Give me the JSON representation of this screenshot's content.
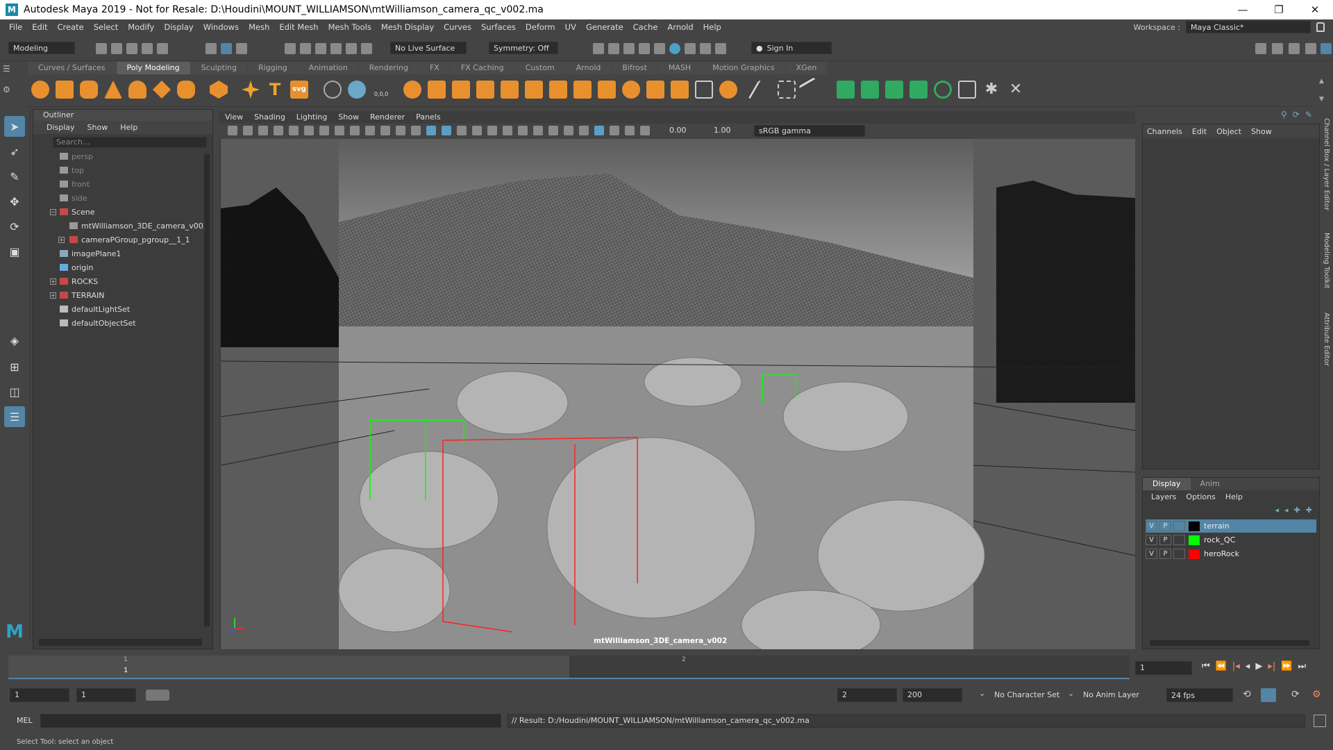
{
  "window": {
    "title": "Autodesk Maya 2019 - Not for Resale: D:\\Houdini\\MOUNT_WILLIAMSON\\mtWilliamson_camera_qc_v002.ma",
    "logo": "M",
    "controls": {
      "minimize": "—",
      "maximize": "❐",
      "close": "✕"
    }
  },
  "menubar": {
    "items": [
      "File",
      "Edit",
      "Create",
      "Select",
      "Modify",
      "Display",
      "Windows",
      "Mesh",
      "Edit Mesh",
      "Mesh Tools",
      "Mesh Display",
      "Curves",
      "Surfaces",
      "Deform",
      "UV",
      "Generate",
      "Cache",
      "Arnold",
      "Help"
    ],
    "workspace_label": "Workspace :",
    "workspace_value": "Maya Classic*"
  },
  "statusline": {
    "mode": "Modeling",
    "live_surface": "No Live Surface",
    "symmetry": "Symmetry: Off",
    "sign_in": "Sign In"
  },
  "shelf": {
    "tabs": [
      "Curves / Surfaces",
      "Poly Modeling",
      "Sculpting",
      "Rigging",
      "Animation",
      "Rendering",
      "FX",
      "FX Caching",
      "Custom",
      "Arnold",
      "Bifrost",
      "MASH",
      "Motion Graphics",
      "XGen"
    ],
    "active_tab": "Poly Modeling",
    "text_tool": "T",
    "svg_tool": "svg",
    "coord_tool": "0,0,0"
  },
  "outliner": {
    "title": "Outliner",
    "menu": [
      "Display",
      "Show",
      "Help"
    ],
    "search_placeholder": "Search...",
    "items": [
      {
        "label": "persp",
        "dim": true,
        "indent": 1,
        "icon": "camera-icon"
      },
      {
        "label": "top",
        "dim": true,
        "indent": 1,
        "icon": "camera-icon"
      },
      {
        "label": "front",
        "dim": true,
        "indent": 1,
        "icon": "camera-icon"
      },
      {
        "label": "side",
        "dim": true,
        "indent": 1,
        "icon": "camera-icon"
      },
      {
        "label": "Scene",
        "dim": false,
        "indent": 1,
        "icon": "group-icon",
        "expand": "−"
      },
      {
        "label": "mtWilliamson_3DE_camera_v002",
        "dim": false,
        "indent": 2,
        "icon": "camera-icon"
      },
      {
        "label": "cameraPGroup_pgroup__1_1",
        "dim": false,
        "indent": 2,
        "icon": "group-icon",
        "expand": "+"
      },
      {
        "label": "imagePlane1",
        "dim": false,
        "indent": 1,
        "icon": "image-plane-icon"
      },
      {
        "label": "origin",
        "dim": false,
        "indent": 1,
        "icon": "locator-icon"
      },
      {
        "label": "ROCKS",
        "dim": false,
        "indent": 1,
        "icon": "group-icon",
        "expand": "+"
      },
      {
        "label": "TERRAIN",
        "dim": false,
        "indent": 1,
        "icon": "group-icon",
        "expand": "+"
      },
      {
        "label": "defaultLightSet",
        "dim": false,
        "indent": 1,
        "icon": "set-icon"
      },
      {
        "label": "defaultObjectSet",
        "dim": false,
        "indent": 1,
        "icon": "set-icon"
      }
    ]
  },
  "viewport": {
    "menu": [
      "View",
      "Shading",
      "Lighting",
      "Show",
      "Renderer",
      "Panels"
    ],
    "exposure": "0.00",
    "gamma": "1.00",
    "color_space": "sRGB gamma",
    "camera_label": "mtWilliamson_3DE_camera_v002"
  },
  "channelbox": {
    "menu": [
      "Channels",
      "Edit",
      "Object",
      "Show"
    ]
  },
  "layers": {
    "tabs": [
      "Display",
      "Anim"
    ],
    "active_tab": "Display",
    "menu": [
      "Layers",
      "Options",
      "Help"
    ],
    "rows": [
      {
        "v": "V",
        "p": "P",
        "name": "terrain",
        "color": "#000000",
        "selected": true
      },
      {
        "v": "V",
        "p": "P",
        "name": "rock_QC",
        "color": "#00ff00",
        "selected": false
      },
      {
        "v": "V",
        "p": "P",
        "name": "heroRock",
        "color": "#ff0000",
        "selected": false
      }
    ]
  },
  "side_tabs": [
    "Channel Box / Layer Editor",
    "Modeling Toolkit",
    "Attribute Editor"
  ],
  "timeline": {
    "tick_1": "1",
    "tick_2": "2",
    "current_frame": "1",
    "current_frame_field": "1"
  },
  "range": {
    "start": "1",
    "playback_start": "1",
    "playback_end": "2",
    "end": "200",
    "character_set": "No Character Set",
    "anim_layer": "No Anim Layer",
    "fps": "24 fps"
  },
  "cmdline": {
    "mode": "MEL",
    "result": "// Result: D:/Houdini/MOUNT_WILLIAMSON/mtWilliamson_camera_qc_v002.ma"
  },
  "helpline": {
    "text": "Select Tool: select an object"
  },
  "colors": {
    "accent": "#5285a6",
    "selection_green": "#00ff00",
    "selection_red": "#ff0000",
    "maya_logo": "#1b8aa8"
  }
}
